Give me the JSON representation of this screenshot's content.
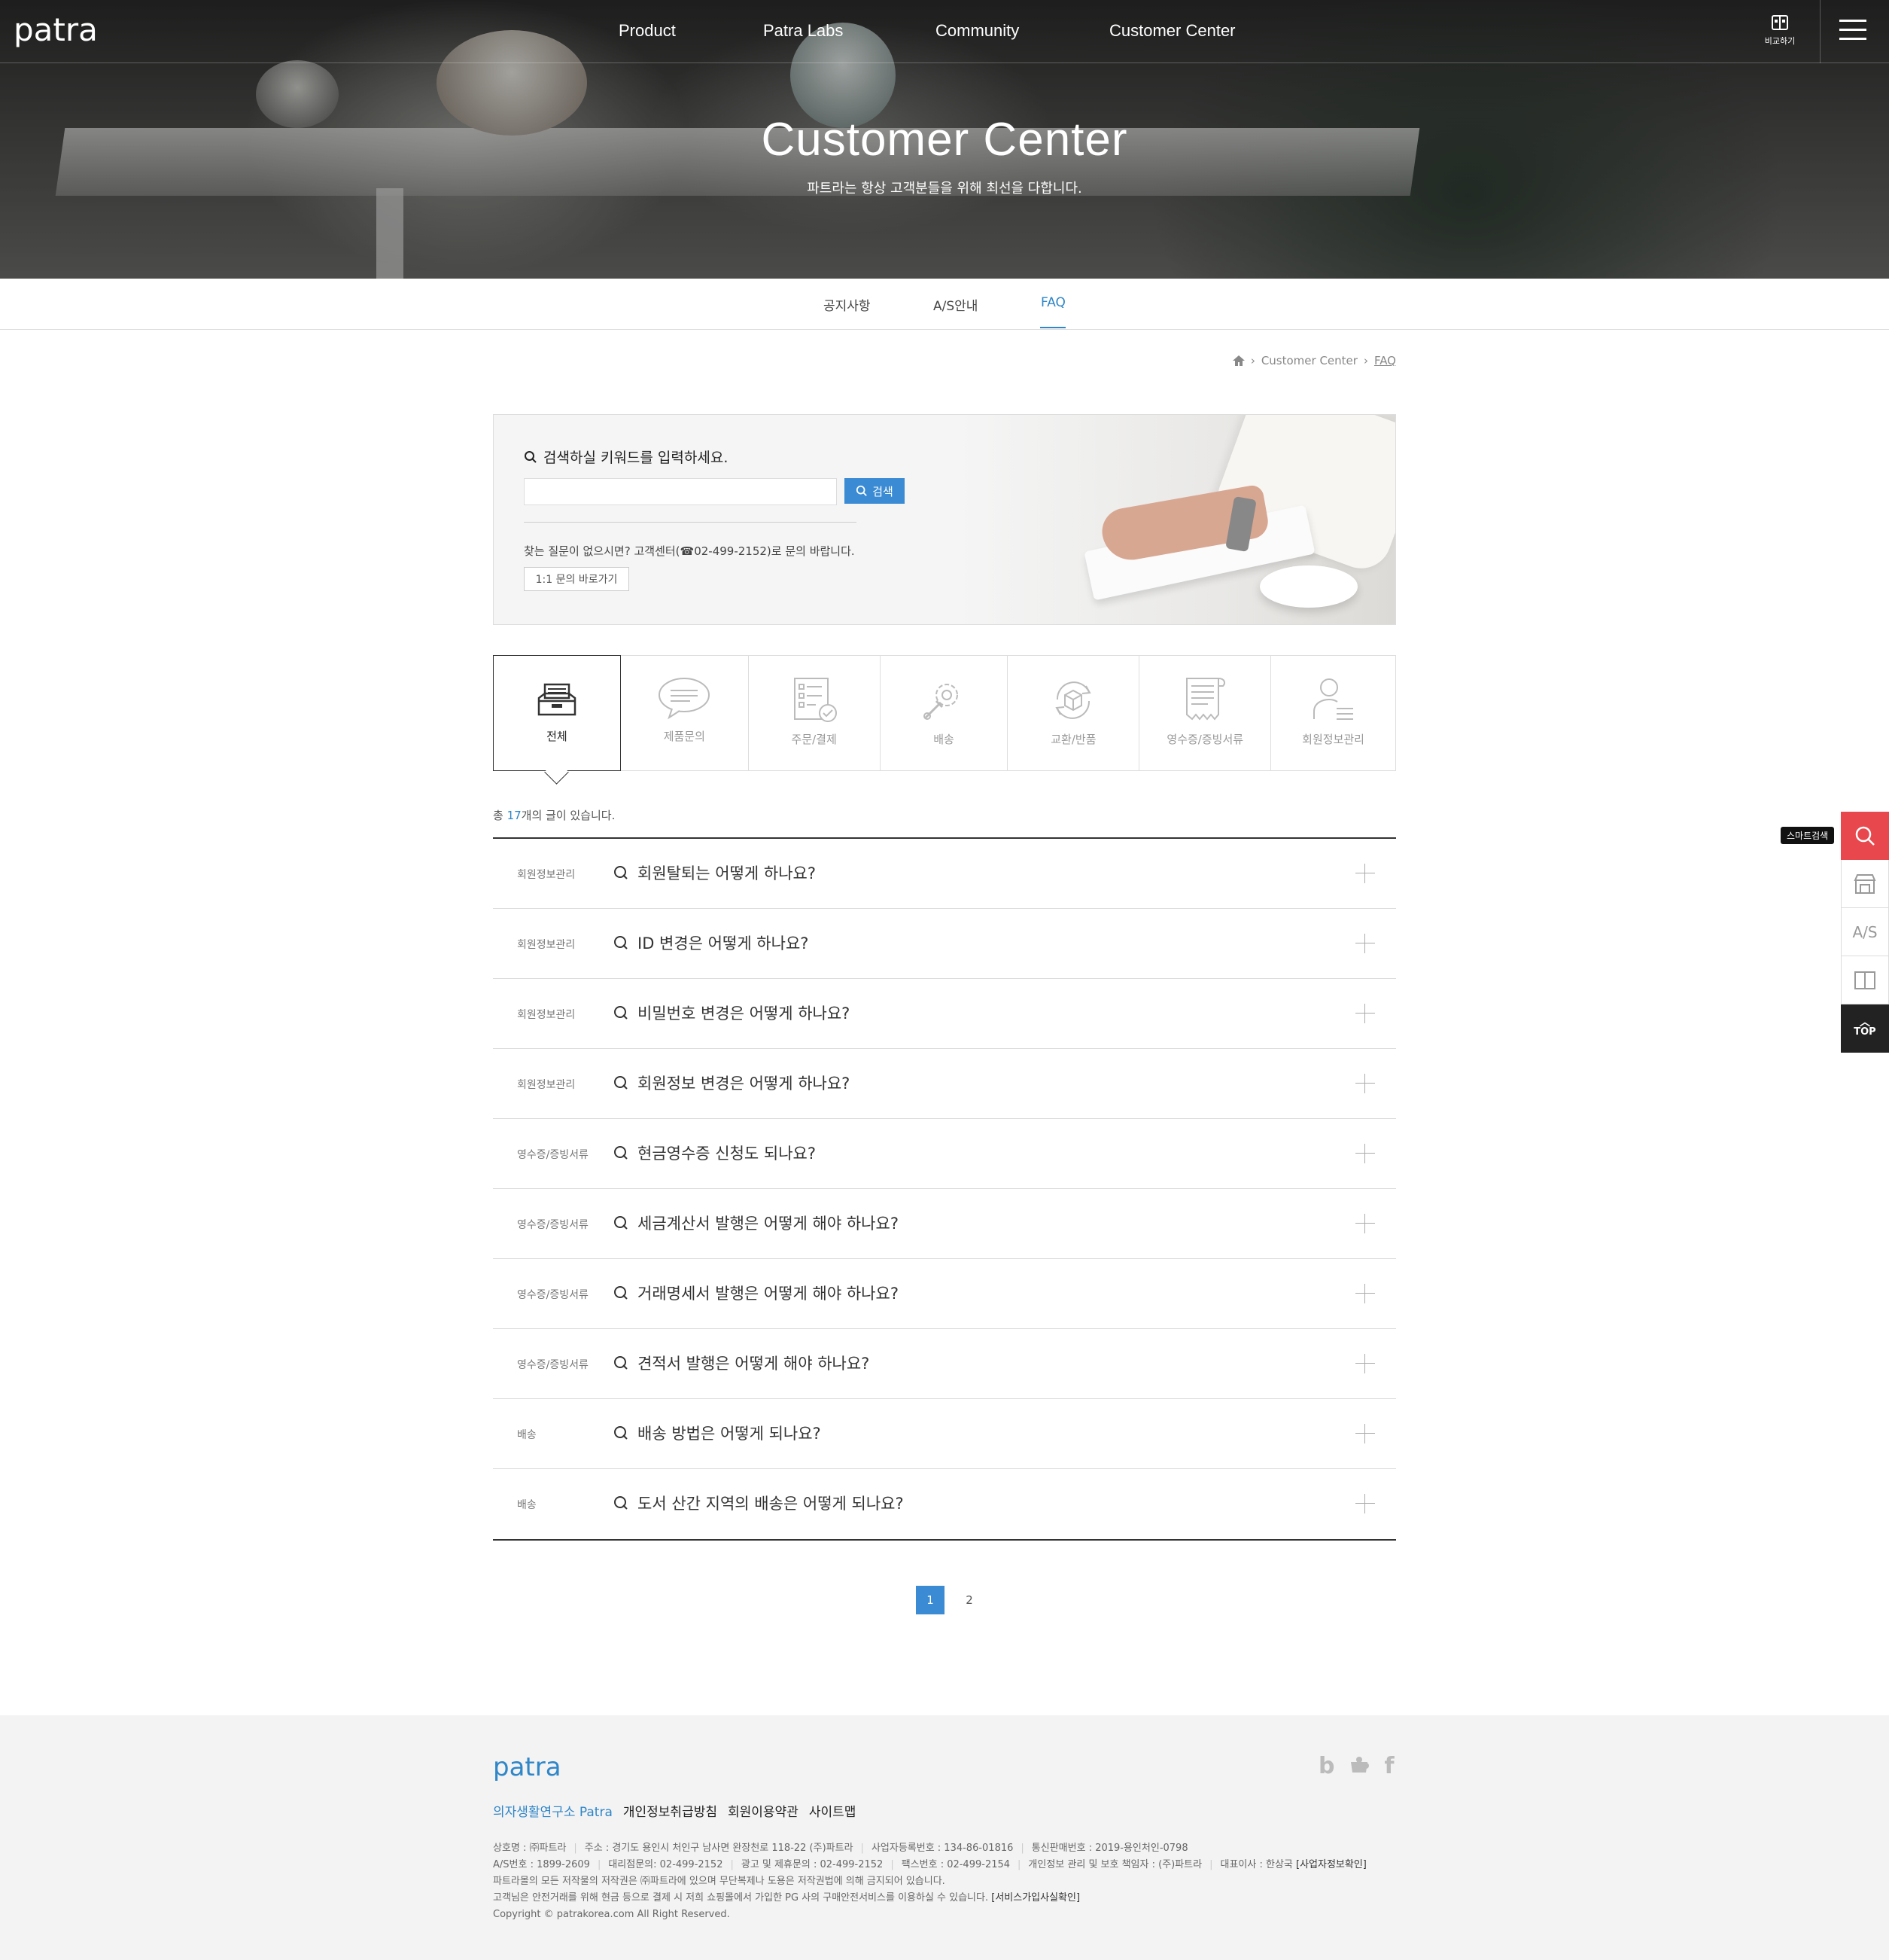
{
  "header": {
    "logo_text": "patra",
    "nav": [
      "Product",
      "Patra Labs",
      "Community",
      "Customer Center"
    ],
    "compare_label": "비교하기"
  },
  "hero": {
    "title": "Customer Center",
    "subtitle": "파트라는 항상 고객분들을 위해 최선을 다합니다."
  },
  "subtabs": [
    {
      "label": "공지사항",
      "active": false
    },
    {
      "label": "A/S안내",
      "active": false
    },
    {
      "label": "FAQ",
      "active": true
    }
  ],
  "breadcrumb": {
    "items": [
      "Customer Center",
      "FAQ"
    ]
  },
  "search": {
    "label": "검색하실 키워드를 입력하세요.",
    "input_value": "",
    "button_label": "검색",
    "help_text": "찾는 질문이 없으시면? 고객센터(☎02-499-2152)로 문의 바랍니다.",
    "inquiry_button": "1:1 문의 바로가기"
  },
  "categories": [
    {
      "label": "전체",
      "icon": "inbox-icon",
      "active": true
    },
    {
      "label": "제품문의",
      "icon": "chat-bubble-icon",
      "active": false
    },
    {
      "label": "주문/결제",
      "icon": "order-checklist-icon",
      "active": false
    },
    {
      "label": "배송",
      "icon": "wrench-gear-icon",
      "active": false
    },
    {
      "label": "교환/반품",
      "icon": "box-exchange-icon",
      "active": false
    },
    {
      "label": "영수증/증빙서류",
      "icon": "receipt-icon",
      "active": false
    },
    {
      "label": "회원정보관리",
      "icon": "user-icon",
      "active": false
    }
  ],
  "total": {
    "prefix": "총 ",
    "count": "17",
    "suffix": "개의 글이 있습니다."
  },
  "faq": [
    {
      "category": "회원정보관리",
      "question": "회원탈퇴는 어떻게 하나요?"
    },
    {
      "category": "회원정보관리",
      "question": "ID 변경은 어떻게 하나요?"
    },
    {
      "category": "회원정보관리",
      "question": "비밀번호 변경은 어떻게 하나요?"
    },
    {
      "category": "회원정보관리",
      "question": "회원정보 변경은 어떻게 하나요?"
    },
    {
      "category": "영수증/증빙서류",
      "question": "현금영수증 신청도 되나요?"
    },
    {
      "category": "영수증/증빙서류",
      "question": "세금계산서 발행은 어떻게 해야 하나요?"
    },
    {
      "category": "영수증/증빙서류",
      "question": "거래명세서 발행은 어떻게 해야 하나요?"
    },
    {
      "category": "영수증/증빙서류",
      "question": "견적서 발행은 어떻게 해야 하나요?"
    },
    {
      "category": "배송",
      "question": "배송 방법은 어떻게 되나요?"
    },
    {
      "category": "배송",
      "question": "도서 산간 지역의 배송은 어떻게 되나요?"
    }
  ],
  "pagination": {
    "pages": [
      "1",
      "2"
    ],
    "current": "1"
  },
  "quick_menu": {
    "tooltip": "스마트검색",
    "as_label": "A/S",
    "top_label": "TOP"
  },
  "footer": {
    "logo_text": "patra",
    "links": [
      "의자생활연구소 Patra",
      "개인정보취급방침",
      "회원이용약관",
      "사이트맵"
    ],
    "sns": [
      "b",
      "f"
    ],
    "line1": [
      "상호명 : ㈜파트라",
      "주소 : 경기도 용인시 처인구 남사면 완장천로 118-22 (주)파트라",
      "사업자등록번호 : 134-86-01816",
      "통신판매번호 : 2019-용인처인-0798"
    ],
    "line2": [
      "A/S번호 : 1899-2609",
      "대리점문의: 02-499-2152",
      "광고 및 제휴문의 : 02-499-2152",
      "팩스번호 : 02-499-2154",
      "개인정보 관리 및 보호 책임자 : (주)파트라",
      "대표이사 : 한상국"
    ],
    "line2_link": "[사업자정보확인]",
    "line3": "파트라몰의 모든 저작물의 저작권은 ㈜파트라에 있으며 무단복제나 도용은 저작권법에 의해 금지되어 있습니다.",
    "line4": "고객님은 안전거래를 위해 현금 등으로 결제 시 저희 쇼핑몰에서 가입한 PG 사의 구매안전서비스를 이용하실 수 있습니다.",
    "line4_link": "[서비스가입사실확인]",
    "copyright": "Copyright © patrakorea.com All Right Reserved."
  },
  "colors": {
    "accent": "#2f86c8",
    "button": "#3a8bd4",
    "quick_red": "#e8484d"
  }
}
